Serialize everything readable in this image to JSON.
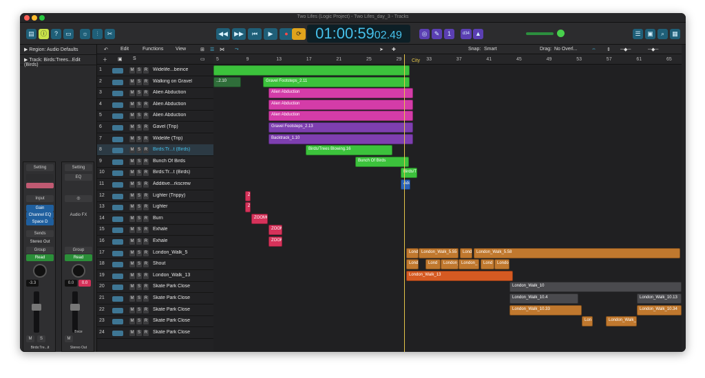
{
  "window": {
    "title": "Two Lifes (Logic Project) - Two Lifes_day_3 - Tracks"
  },
  "control_bar": {
    "lcd_main": "01:00:59",
    "lcd_small": "02.49",
    "tempo_label": "d34"
  },
  "inspector": {
    "region_label": "Region: Audio Defaults",
    "track_label": "Track: Birds:Trees...Edit (Birds)",
    "strip1": {
      "setting": "Setting",
      "input": "Input",
      "plugins": [
        "Gain",
        "Channel EQ",
        "Space D"
      ],
      "sends": "Sends",
      "output": "Stereo Out",
      "group": "Group",
      "automation": "Read",
      "volume": "-3.3",
      "name": "Birds:Tre...it (Birds)"
    },
    "strip2": {
      "setting": "Setting",
      "eq": "EQ",
      "audio_fx": "Audio FX",
      "group": "Group",
      "automation": "Read",
      "vol_a": "0.0",
      "vol_b": "0.0",
      "bounce": "Bnce",
      "name": "Stereo Out"
    }
  },
  "toolbar": {
    "edit": "Edit",
    "functions": "Functions",
    "view": "View",
    "snap_label": "Snap:",
    "snap_value": "Smart",
    "drag_label": "Drag:",
    "drag_value": "No Overl..."
  },
  "ruler": {
    "ticks": [
      "5",
      "9",
      "13",
      "17",
      "21",
      "25",
      "29",
      "33",
      "37",
      "41",
      "45",
      "49",
      "53",
      "57",
      "61",
      "65"
    ],
    "marker": "City"
  },
  "tracks": [
    {
      "num": "1",
      "name": "Widelife...beince"
    },
    {
      "num": "2",
      "name": "Walking on Gravel"
    },
    {
      "num": "3",
      "name": "Alien Abduction"
    },
    {
      "num": "4",
      "name": "Alien Abduction"
    },
    {
      "num": "5",
      "name": "Alien Abduction"
    },
    {
      "num": "6",
      "name": "Gavel (Trip)"
    },
    {
      "num": "7",
      "name": "Widelife (Trip)"
    },
    {
      "num": "8",
      "name": "Birds:Tr...t (Birds)"
    },
    {
      "num": "9",
      "name": "Bunch Of Birds"
    },
    {
      "num": "10",
      "name": "Birds:Tr...t (Birds)"
    },
    {
      "num": "11",
      "name": "Additive...rkscrew"
    },
    {
      "num": "12",
      "name": "Lighter (Trippy)"
    },
    {
      "num": "13",
      "name": "Lighter"
    },
    {
      "num": "14",
      "name": "Burn"
    },
    {
      "num": "15",
      "name": "Exhale"
    },
    {
      "num": "16",
      "name": "Exhale"
    },
    {
      "num": "17",
      "name": "London_Walk_5"
    },
    {
      "num": "18",
      "name": "Shout"
    },
    {
      "num": "19",
      "name": "London_Walk_13"
    },
    {
      "num": "20",
      "name": "Skate Park Close"
    },
    {
      "num": "21",
      "name": "Skate Park Close"
    },
    {
      "num": "22",
      "name": "Skate Park Close"
    },
    {
      "num": "23",
      "name": "Skate Park Close"
    },
    {
      "num": "24",
      "name": "Skate Park Close"
    }
  ],
  "regions": [
    {
      "label": "",
      "color": "#3cc23c"
    },
    {
      "label": "..2.10",
      "color": "#2f6e3a"
    },
    {
      "label": "Gravel Footsteps_2.11",
      "color": "#3cc23c"
    },
    {
      "label": "Alien Abduction",
      "color": "#d43ca8"
    },
    {
      "label": "Alien Abduction",
      "color": "#d43ca8"
    },
    {
      "label": "Alien Abduction",
      "color": "#d43ca8"
    },
    {
      "label": "Gravel Footsteps_2.13",
      "color": "#7e3fb0"
    },
    {
      "label": "Backtrack_1.10",
      "color": "#7e3fb0"
    },
    {
      "label": "Birds/Trees Blowing.16",
      "color": "#3cc23c"
    },
    {
      "label": "Bunch Of Birds",
      "color": "#3cc23c"
    },
    {
      "label": "Birds/Tr",
      "color": "#3cc23c"
    },
    {
      "label": "Addi",
      "color": "#2a62b8"
    },
    {
      "label": "Z",
      "color": "#d6325a"
    },
    {
      "label": "Z",
      "color": "#d6325a"
    },
    {
      "label": "ZOOM0",
      "color": "#d6325a"
    },
    {
      "label": "ZOOM",
      "color": "#d6325a"
    },
    {
      "label": "ZOOM",
      "color": "#d6325a"
    },
    {
      "label": "Lond",
      "color": "#c0782e"
    },
    {
      "label": "London_Walk_5.55",
      "color": "#c0782e"
    },
    {
      "label": "Lond",
      "color": "#c0782e"
    },
    {
      "label": "London_Walk_5.58",
      "color": "#c0782e"
    },
    {
      "label": "Lond",
      "color": "#c0782e"
    },
    {
      "label": "Lond",
      "color": "#c0782e"
    },
    {
      "label": "London_",
      "color": "#c0782e"
    },
    {
      "label": "London_",
      "color": "#c0782e"
    },
    {
      "label": "Lond",
      "color": "#c0782e"
    },
    {
      "label": "London_",
      "color": "#c0782e"
    },
    {
      "label": "London_Walk_13",
      "color": "#d65a22"
    },
    {
      "label": "London_Walk_10",
      "color": "#4a4a4e"
    },
    {
      "label": "London_Walk_10.4",
      "color": "#4a4a4e"
    },
    {
      "label": "London_Walk_10.13",
      "color": "#4a4a4e"
    },
    {
      "label": "London_Walk_10.33",
      "color": "#c0782e"
    },
    {
      "label": "London_Walk_10.34",
      "color": "#c0782e"
    },
    {
      "label": "Lon",
      "color": "#c0782e"
    },
    {
      "label": "London_Walk_1",
      "color": "#c0782e"
    }
  ]
}
